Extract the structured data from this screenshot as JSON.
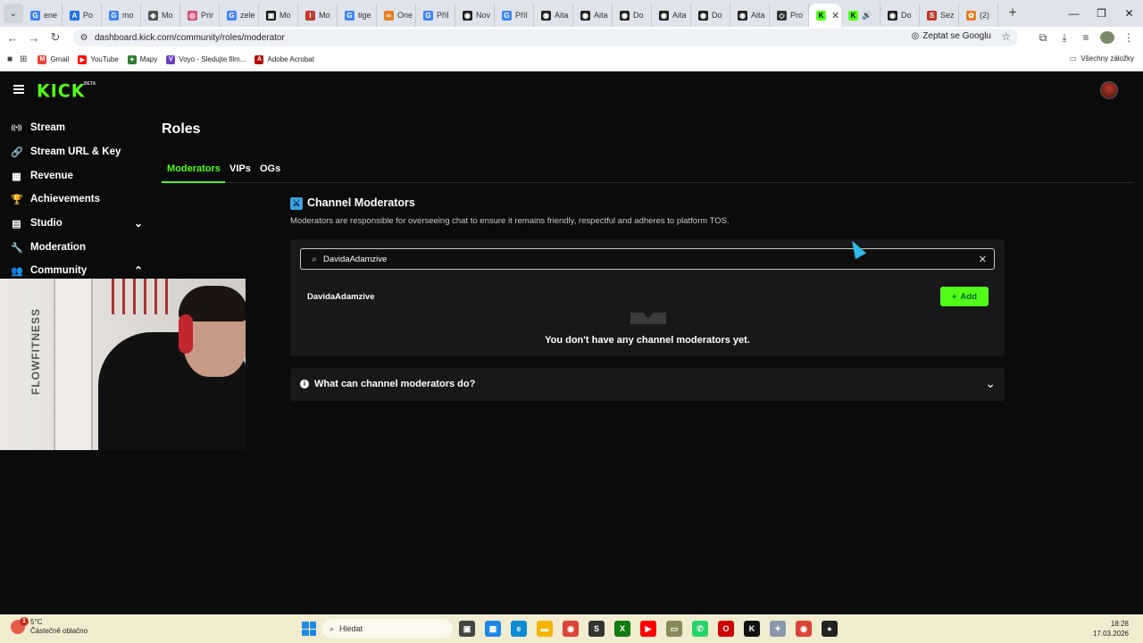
{
  "browser": {
    "tabs": [
      {
        "label": "ene",
        "color": "#4285f4",
        "glyph": "G"
      },
      {
        "label": "Po",
        "color": "#1a73e8",
        "glyph": "A"
      },
      {
        "label": "mo",
        "color": "#4285f4",
        "glyph": "G"
      },
      {
        "label": "Mo",
        "color": "#555555",
        "glyph": "◆"
      },
      {
        "label": "Prir",
        "color": "#d64f7a",
        "glyph": "◎"
      },
      {
        "label": "zele",
        "color": "#4285f4",
        "glyph": "G"
      },
      {
        "label": "Mo",
        "color": "#111111",
        "glyph": "▣"
      },
      {
        "label": "Mo",
        "color": "#c0392b",
        "glyph": "I"
      },
      {
        "label": "tige",
        "color": "#4285f4",
        "glyph": "G"
      },
      {
        "label": "One",
        "color": "#e67e22",
        "glyph": "∞"
      },
      {
        "label": "Příl",
        "color": "#4285f4",
        "glyph": "G"
      },
      {
        "label": "Nov",
        "color": "#222222",
        "glyph": "◉"
      },
      {
        "label": "Příl",
        "color": "#4285f4",
        "glyph": "G"
      },
      {
        "label": "Aita",
        "color": "#222222",
        "glyph": "◉"
      },
      {
        "label": "Aita",
        "color": "#222222",
        "glyph": "◉"
      },
      {
        "label": "Do",
        "color": "#222222",
        "glyph": "◉"
      },
      {
        "label": "Aita",
        "color": "#222222",
        "glyph": "◉"
      },
      {
        "label": "Do",
        "color": "#222222",
        "glyph": "◉"
      },
      {
        "label": "Aita",
        "color": "#222222",
        "glyph": "◉"
      },
      {
        "label": "Pro",
        "color": "#333333",
        "glyph": "◇"
      }
    ],
    "active_tab_glyph": "K",
    "after_tabs": [
      {
        "label": "",
        "color": "#53fc18",
        "glyph": "K",
        "speaker": "🔊"
      },
      {
        "label": "Do",
        "color": "#222222",
        "glyph": "◉"
      },
      {
        "label": "Sez",
        "color": "#c0392b",
        "glyph": "S"
      },
      {
        "label": "(2)",
        "color": "#e67e22",
        "glyph": "✿"
      }
    ],
    "new_tab": "+",
    "window_controls": [
      "—",
      "❐",
      "✕"
    ],
    "url": "dashboard.kick.com/community/roles/moderator",
    "ask_google": "Zeptat se Googlu",
    "bookmarks": [
      {
        "label": "Gmail",
        "color": "#ea4335",
        "glyph": "M"
      },
      {
        "label": "YouTube",
        "color": "#ff0000",
        "glyph": "▶"
      },
      {
        "label": "Mapy",
        "color": "#2e7d32",
        "glyph": "✦"
      },
      {
        "label": "Voyo - Sledujte film...",
        "color": "#6a3fbf",
        "glyph": "V"
      },
      {
        "label": "Adobe Acrobat",
        "color": "#b30b00",
        "glyph": "A"
      }
    ],
    "all_bookmarks": "Všechny záložky"
  },
  "kick": {
    "logo": "KICK",
    "beta": "BETA",
    "sidebar": [
      {
        "label": "Stream",
        "icon": "((•))",
        "name": "stream"
      },
      {
        "label": "Stream URL & Key",
        "icon": "🔗",
        "name": "stream-url-key"
      },
      {
        "label": "Revenue",
        "icon": "▦",
        "name": "revenue"
      },
      {
        "label": "Achievements",
        "icon": "🏆",
        "name": "achievements"
      },
      {
        "label": "Studio",
        "icon": "▤",
        "name": "studio",
        "chevron": "⌄"
      },
      {
        "label": "Moderation",
        "icon": "🔧",
        "name": "moderation"
      },
      {
        "label": "Community",
        "icon": "👥",
        "name": "community",
        "chevron": "⌃"
      }
    ],
    "page_title": "Roles",
    "tabs": [
      "Moderators",
      "VIPs",
      "OGs"
    ],
    "section": {
      "title": "Channel Moderators",
      "description": "Moderators are responsible for overseeing chat to ensure it remains friendly, respectful and adheres to platform TOS.",
      "search_value": "DavidaAdamzive",
      "result_name": "DavidaAdamzive",
      "add_label": "Add",
      "empty_text": "You don't have any channel moderators yet.",
      "faq_title": "What can channel moderators do?"
    }
  },
  "webcam": {
    "wall_text": "FLOWFITNESS"
  },
  "taskbar": {
    "weather_temp": "5°C",
    "weather_desc": "Částečně oblačno",
    "weather_badge": "1",
    "search_placeholder": "Hledat",
    "time": "18:28",
    "date": "17.03.2026",
    "apps": [
      {
        "name": "task-view",
        "color": "#444444",
        "glyph": "▣"
      },
      {
        "name": "store",
        "color": "#1e88e5",
        "glyph": "▦"
      },
      {
        "name": "edge",
        "color": "#0c8bd6",
        "glyph": "e"
      },
      {
        "name": "explorer",
        "color": "#f4b400",
        "glyph": "▬"
      },
      {
        "name": "chrome",
        "color": "#db4437",
        "glyph": "◉"
      },
      {
        "name": "steam-like",
        "color": "#333333",
        "glyph": "S"
      },
      {
        "name": "xbox",
        "color": "#107c10",
        "glyph": "X"
      },
      {
        "name": "youtube",
        "color": "#ff0000",
        "glyph": "▶"
      },
      {
        "name": "app-olive",
        "color": "#8a8a5a",
        "glyph": "▭"
      },
      {
        "name": "whatsapp",
        "color": "#25d366",
        "glyph": "✆"
      },
      {
        "name": "opera",
        "color": "#d00000",
        "glyph": "O"
      },
      {
        "name": "kick",
        "color": "#111111",
        "glyph": "K"
      },
      {
        "name": "app-gray",
        "color": "#8899aa",
        "glyph": "✦"
      },
      {
        "name": "chrome-2",
        "color": "#db4437",
        "glyph": "◉"
      },
      {
        "name": "obs",
        "color": "#222222",
        "glyph": "●"
      }
    ]
  }
}
